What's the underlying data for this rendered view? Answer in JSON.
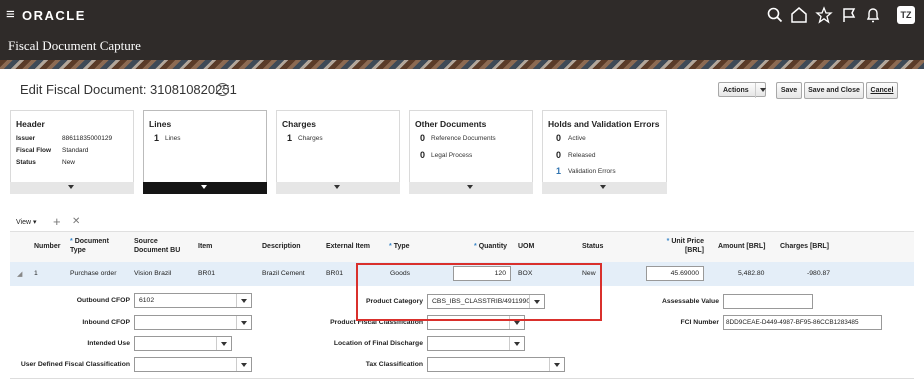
{
  "topbar": {
    "menu_glyph": "≡",
    "brand": "ORACLE",
    "avatar": "TZ",
    "icons": [
      "search-icon",
      "home-icon",
      "star-icon",
      "flag-icon",
      "bell-icon"
    ]
  },
  "page": {
    "app_title": "Fiscal Document Capture",
    "title": "Edit Fiscal Document: 310810820251",
    "help_glyph": "?"
  },
  "actions": {
    "actions_label": "Actions",
    "save_label": "Save",
    "save_close_label": "Save and Close",
    "cancel_label": "Cancel"
  },
  "tiles": {
    "header": {
      "title": "Header",
      "issuer_label": "Issuer",
      "issuer_value": "88611835000129",
      "flow_label": "Fiscal Flow",
      "flow_value": "Standard",
      "status_label": "Status",
      "status_value": "New"
    },
    "lines": {
      "title": "Lines",
      "count": "1",
      "label": "Lines"
    },
    "charges": {
      "title": "Charges",
      "count": "1",
      "label": "Charges"
    },
    "other": {
      "title": "Other Documents",
      "ref_count": "0",
      "ref_label": "Reference Documents",
      "legal_count": "0",
      "legal_label": "Legal Process"
    },
    "holds": {
      "title": "Holds and Validation Errors",
      "active_count": "0",
      "active_label": "Active",
      "released_count": "0",
      "released_label": "Released",
      "errors_count": "1",
      "errors_label": "Validation Errors"
    }
  },
  "toolbar": {
    "view_label": "View ▾",
    "add_glyph": "+",
    "delete_glyph": "✕"
  },
  "table": {
    "headers": {
      "number": "Number",
      "doc_type_1": "Document",
      "doc_type_2": "Type",
      "source_1": "Source",
      "source_2": "Document BU",
      "item": "Item",
      "description": "Description",
      "external_item": "External Item",
      "type": "Type",
      "quantity": "Quantity",
      "uom": "UOM",
      "status": "Status",
      "unit_price_1": "Unit Price",
      "unit_price_2": "[BRL]",
      "amount": "Amount [BRL]",
      "charges": "Charges [BRL]",
      "req": "*"
    },
    "row": {
      "number": "1",
      "doc_type": "Purchase order",
      "source_bu": "Vision Brazil",
      "item": "BR01",
      "description": "Brazil Cement",
      "external_item": "BR01",
      "type": "Goods",
      "quantity": "120",
      "uom": "BOX",
      "status": "New",
      "unit_price": "45.69000",
      "amount": "5,482.80",
      "charges": "-980.87"
    }
  },
  "details": {
    "outbound_cfop_label": "Outbound CFOP",
    "outbound_cfop_value": "6102",
    "inbound_cfop_label": "Inbound CFOP",
    "inbound_cfop_value": "",
    "intended_use_label": "Intended Use",
    "intended_use_value": "",
    "udfc_label": "User Defined Fiscal Classification",
    "udfc_value": "",
    "product_category_label": "Product Category",
    "product_category_value": "CBS_IBS_CLASSTRIB/4911990",
    "product_fiscal_label": "Product Fiscal Classification",
    "product_fiscal_value": "",
    "final_discharge_label": "Location of Final Discharge",
    "final_discharge_value": "",
    "tax_class_label": "Tax Classification",
    "tax_class_value": "",
    "assessable_label": "Assessable Value",
    "assessable_value": "",
    "fci_label": "FCI Number",
    "fci_value": "8DD9CEAE-D449-4987-BF95-86CCB1283485"
  }
}
